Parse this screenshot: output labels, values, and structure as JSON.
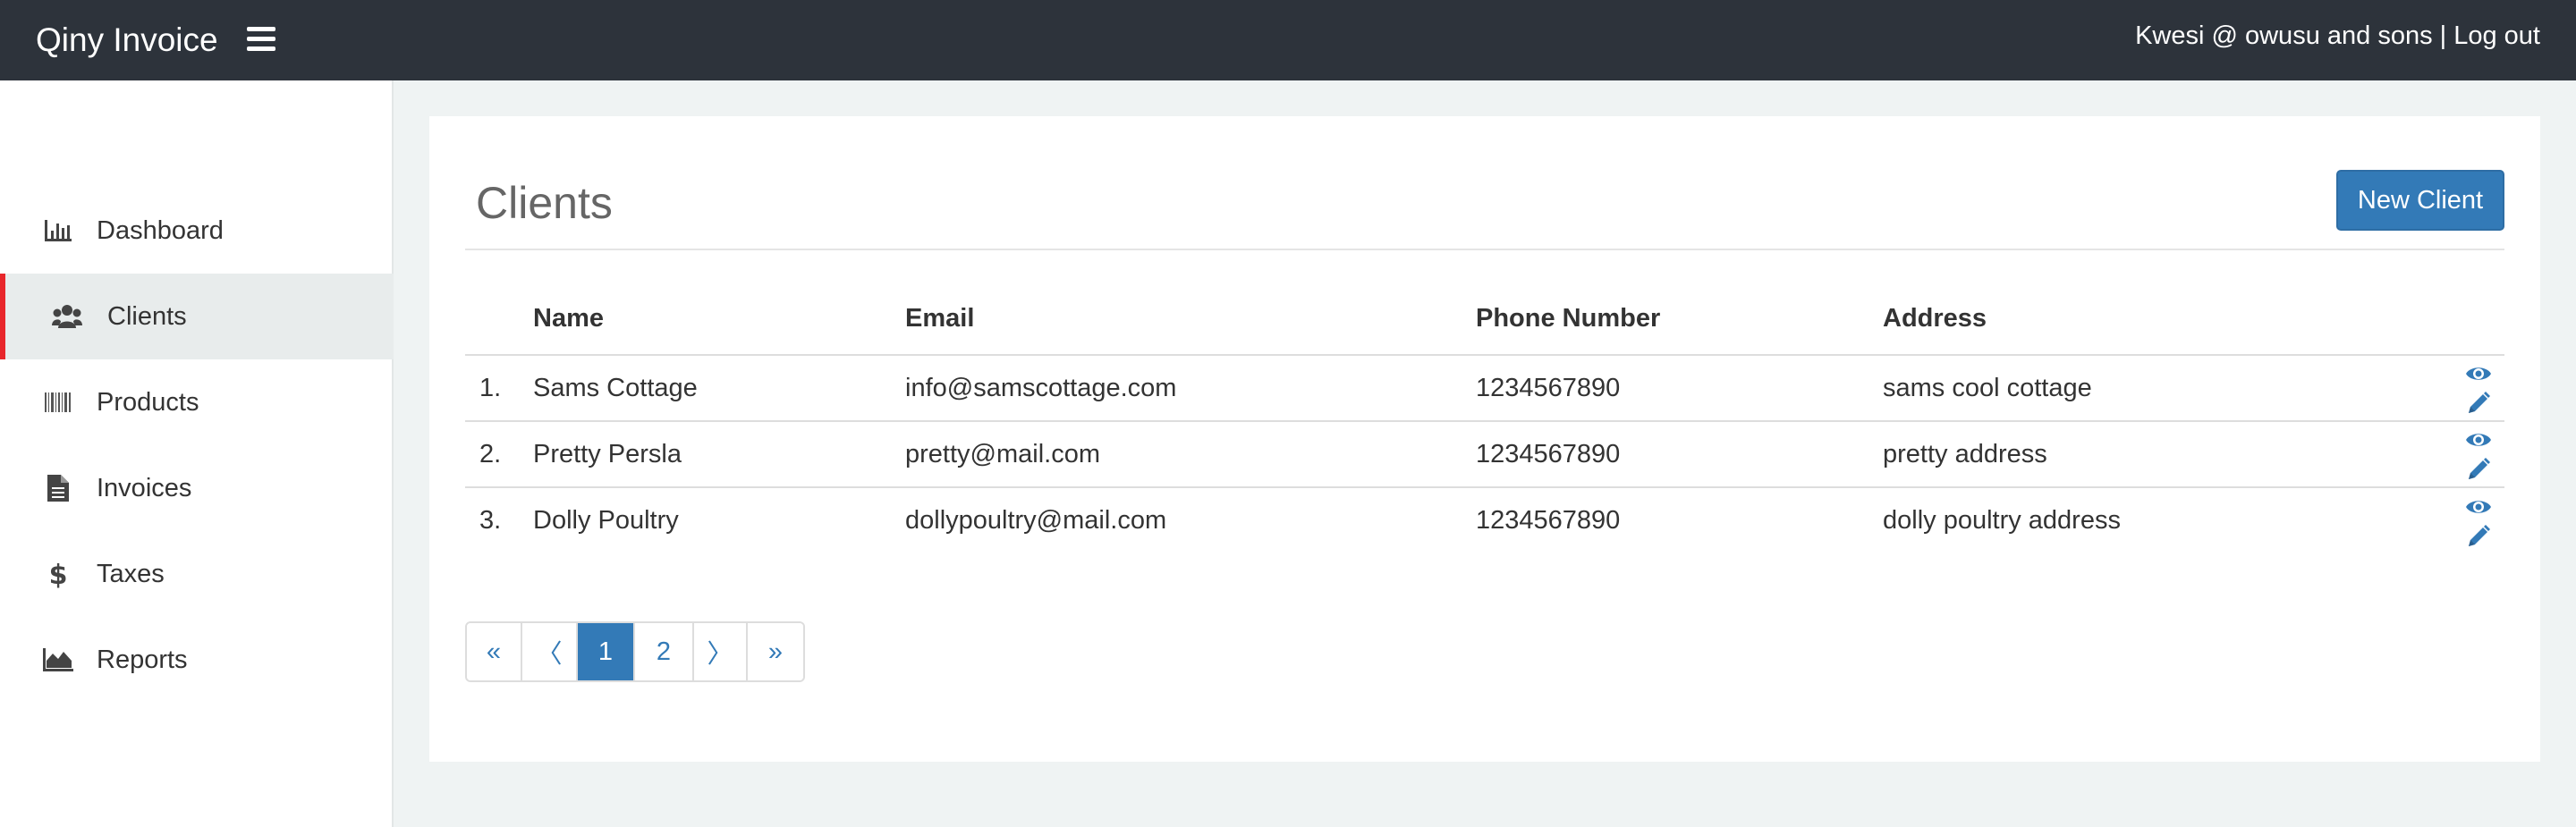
{
  "header": {
    "brand": "Qiny Invoice",
    "user_text": "Kwesi @ owusu and sons",
    "separator": " | ",
    "logout_label": "Log out"
  },
  "sidebar": {
    "items": [
      {
        "label": "Dashboard",
        "icon": "bar-chart-icon",
        "active": false
      },
      {
        "label": "Clients",
        "icon": "users-icon",
        "active": true
      },
      {
        "label": "Products",
        "icon": "barcode-icon",
        "active": false
      },
      {
        "label": "Invoices",
        "icon": "file-text-icon",
        "active": false
      },
      {
        "label": "Taxes",
        "icon": "dollar-icon",
        "active": false
      },
      {
        "label": "Reports",
        "icon": "area-chart-icon",
        "active": false
      }
    ]
  },
  "main": {
    "title": "Clients",
    "new_button_label": "New Client",
    "table": {
      "headers": [
        "",
        "Name",
        "Email",
        "Phone Number",
        "Address",
        ""
      ],
      "rows": [
        {
          "num": "1.",
          "name": "Sams Cottage",
          "email": "info@samscottage.com",
          "phone": "1234567890",
          "address": "sams cool cottage"
        },
        {
          "num": "2.",
          "name": "Pretty Persla",
          "email": "pretty@mail.com",
          "phone": "1234567890",
          "address": "pretty address"
        },
        {
          "num": "3.",
          "name": "Dolly Poultry",
          "email": "dollypoultry@mail.com",
          "phone": "1234567890",
          "address": "dolly poultry address"
        }
      ]
    },
    "pagination": {
      "first": "«",
      "prev": "〈",
      "pages": [
        "1",
        "2"
      ],
      "current_page": "1",
      "next": "〉",
      "last": "»"
    }
  },
  "colors": {
    "topbar": "#2d333b",
    "accent": "#337ab7",
    "active_marker": "#e8262b",
    "background": "#eff3f3"
  }
}
